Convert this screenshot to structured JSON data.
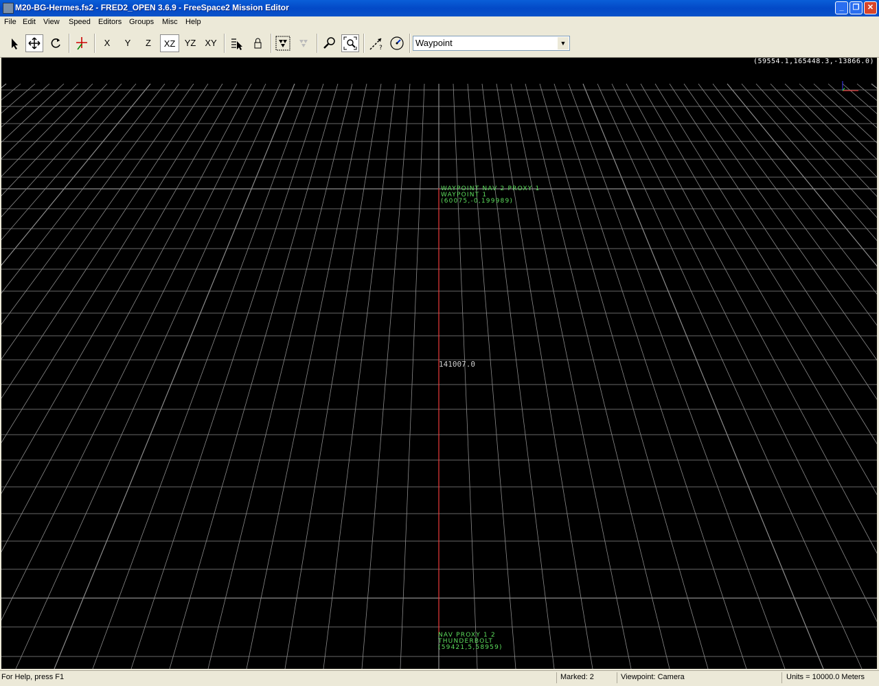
{
  "window": {
    "title": "M20-BG-Hermes.fs2 - FRED2_OPEN 3.6.9 - FreeSpace2 Mission Editor",
    "minimize": "_",
    "maximize": "❐",
    "close": "✕"
  },
  "menu": [
    "File",
    "Edit",
    "View",
    "Speed",
    "Editors",
    "Groups",
    "Misc",
    "Help"
  ],
  "toolbar": {
    "axes": {
      "x": "X",
      "y": "Y",
      "z": "Z",
      "xz": "XZ",
      "yz": "YZ",
      "xy": "XY"
    },
    "object_type": "Waypoint"
  },
  "viewport": {
    "coords": "(59554.1,165448.3,-13866.0)",
    "distance": "141007.0",
    "labels": {
      "top": [
        "Waypoint Nav 2 Proxy 1",
        "Waypoint 1",
        "(60075,-0,199989)"
      ],
      "bottom": [
        "Nav Proxy 1 2",
        "Thunderbolt",
        "(59421,5,58959)"
      ]
    },
    "colors": {
      "grid": "#8c8c8c",
      "selection_line": "#ff2a2a",
      "label": "#5dde5d",
      "background": "#000000"
    }
  },
  "status": {
    "help": "For Help, press F1",
    "marked": "Marked: 2",
    "viewpoint": "Viewpoint: Camera",
    "units": "Units = 10000.0 Meters"
  }
}
